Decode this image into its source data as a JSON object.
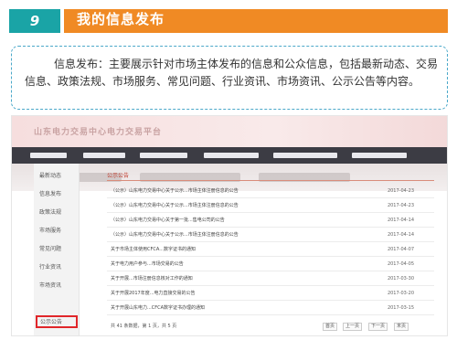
{
  "header": {
    "number": "9",
    "title": "我的信息发布"
  },
  "description": "信息发布：主要展示针对市场主体发布的信息和公众信息，包括最新动态、交易信息、政策法规、市场服务、常见问题、行业资讯、市场资讯、公示公告等内容。",
  "site": {
    "logo": "山东电力交易中心电力交易平台",
    "sidebar": [
      {
        "label": "最新动态"
      },
      {
        "label": "信息发布"
      },
      {
        "label": "政策法规"
      },
      {
        "label": "市场服务"
      },
      {
        "label": "常见问题"
      },
      {
        "label": "行业资讯"
      },
      {
        "label": "市场资讯"
      },
      {
        "label": "公示公告",
        "active": true
      }
    ],
    "panel_title": "公示公告",
    "rows": [
      {
        "title": "（公示）山东电力交易中心关于公示...市场主体注册信息的公告",
        "date": "2017-04-23"
      },
      {
        "title": "（公示）山东电力交易中心关于公示...市场主体注册信息的公告",
        "date": "2017-04-23"
      },
      {
        "title": "（公示）山东电力交易中心关于第一批...售电公司的公告",
        "date": "2017-04-14"
      },
      {
        "title": "（公示）山东电力交易中心关于公示...市场主体注册信息的公告",
        "date": "2017-04-14"
      },
      {
        "title": "关于市场主体使用CFCA...数字证书的通知",
        "date": "2017-04-07"
      },
      {
        "title": "关于电力用户参与...市场交易的公告",
        "date": "2017-04-05"
      },
      {
        "title": "关于开展...市场注册信息核对工作的通知",
        "date": "2017-03-30"
      },
      {
        "title": "关于开展2017年度...电力直接交易的公告",
        "date": "2017-03-20"
      },
      {
        "title": "关于开展山东电力...CFCA数字证书办理的通知",
        "date": "2017-03-15"
      }
    ],
    "pager": {
      "summary": "共 41 条数据，第 1 页，共 5 页",
      "buttons": [
        "首页",
        "上一页",
        "下一页",
        "末页"
      ]
    }
  },
  "colors": {
    "accent_teal": "#1aa4a6",
    "accent_orange": "#f08a24",
    "highlight_red": "#e0262a"
  }
}
